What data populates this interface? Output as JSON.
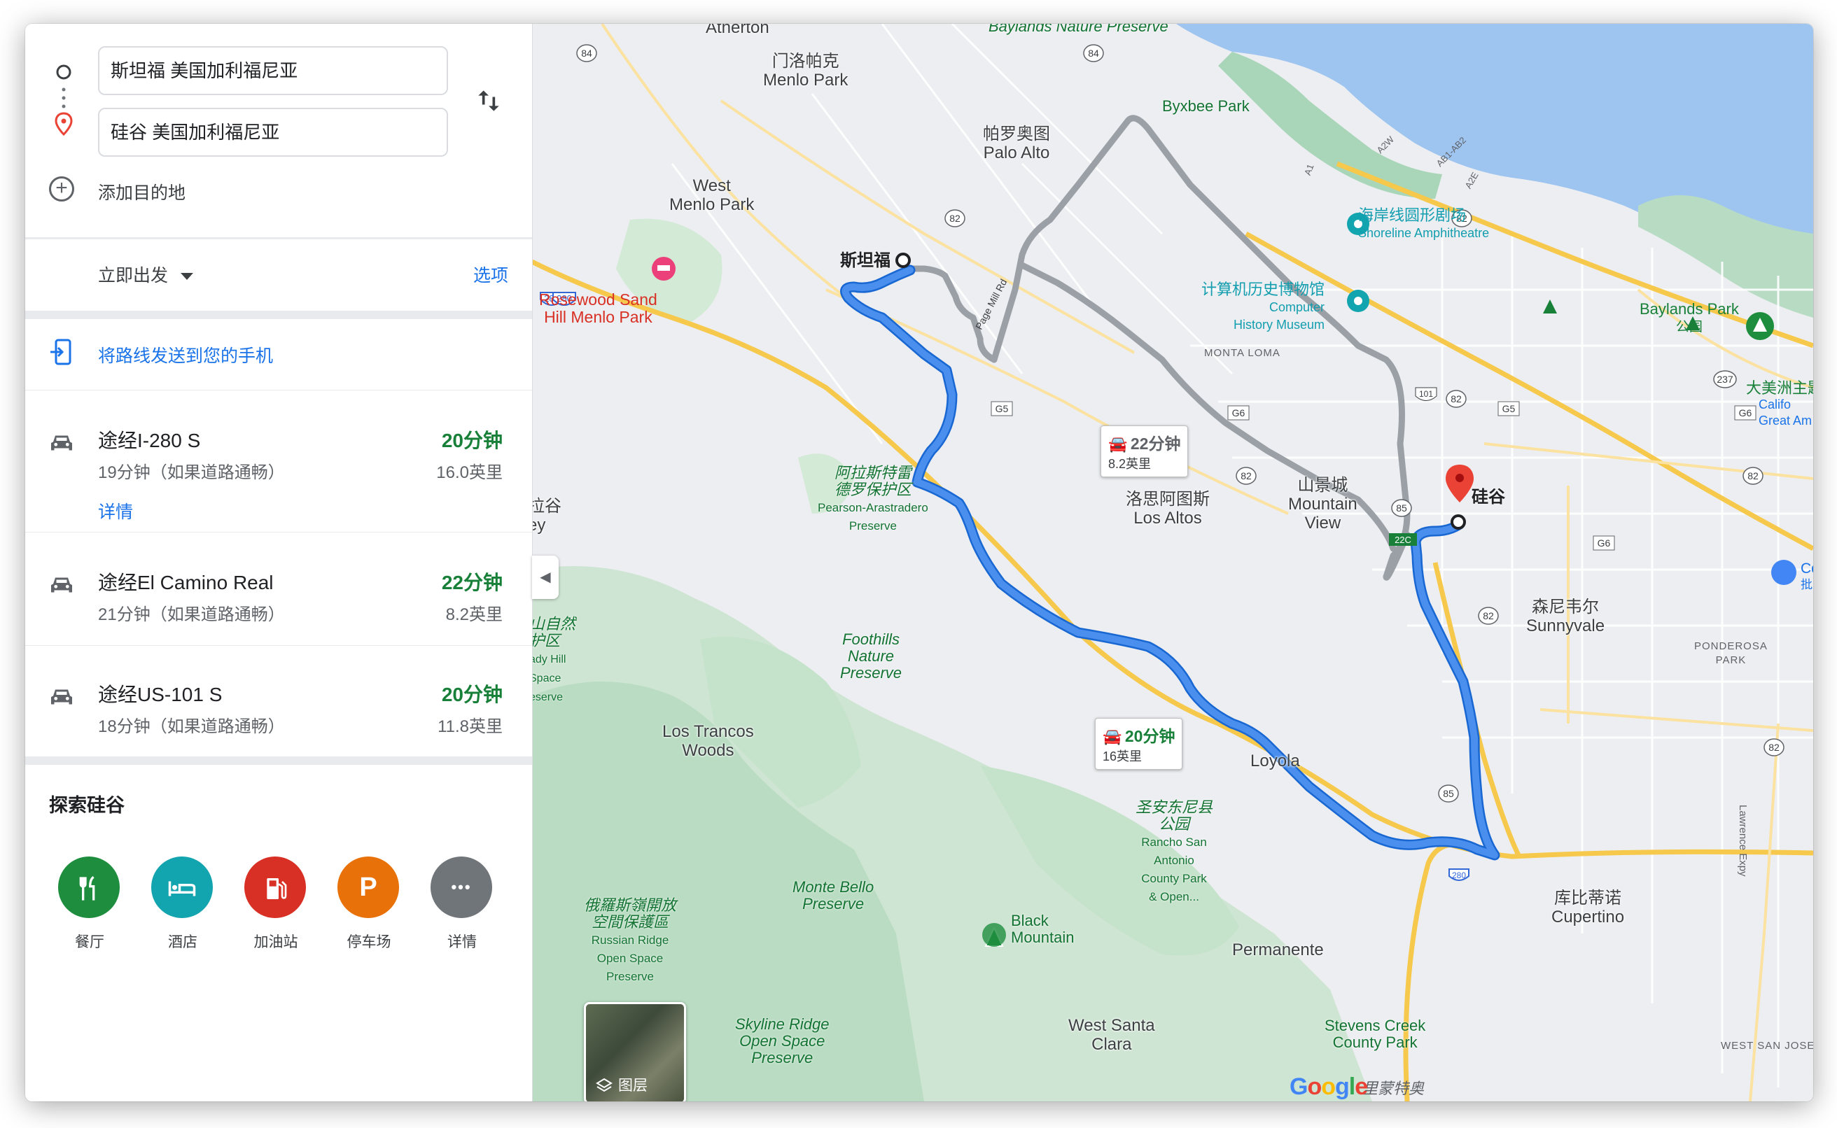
{
  "directions": {
    "origin": "斯坦福 美国加利福尼亚",
    "destination": "硅谷 美国加利福尼亚",
    "add_destination": "添加目的地",
    "depart_label": "立即出发",
    "options_label": "选项",
    "send_to_phone": "将路线发送到您的手机"
  },
  "routes": [
    {
      "title": "途经I-280 S",
      "subtitle": "19分钟（如果道路通畅）",
      "time": "20分钟",
      "distance": "16.0英里",
      "details": "详情"
    },
    {
      "title": "途经El Camino Real",
      "subtitle": "21分钟（如果道路通畅）",
      "time": "22分钟",
      "distance": "8.2英里"
    },
    {
      "title": "途经US-101 S",
      "subtitle": "18分钟（如果道路通畅）",
      "time": "20分钟",
      "distance": "11.8英里"
    }
  ],
  "explore": {
    "title": "探索硅谷",
    "categories": [
      {
        "label": "餐厅",
        "icon": "restaurant-icon",
        "glyph": "🍴",
        "color": "#1e8e3e"
      },
      {
        "label": "酒店",
        "icon": "hotel-icon",
        "glyph": "🛏",
        "color": "#12a4af"
      },
      {
        "label": "加油站",
        "icon": "gas-station-icon",
        "glyph": "⛽",
        "color": "#d93025"
      },
      {
        "label": "停车场",
        "icon": "parking-icon",
        "glyph": "P",
        "color": "#e8710a"
      },
      {
        "label": "详情",
        "icon": "more-icon",
        "glyph": "•••",
        "color": "#70757a"
      }
    ]
  },
  "map": {
    "layers_label": "图层",
    "route_badges": [
      {
        "time": "22分钟",
        "distance": "8.2英里",
        "color": "#5f6368"
      },
      {
        "time": "20分钟",
        "distance": "16英里",
        "color": "#188038"
      }
    ],
    "origin_label": "斯坦福",
    "destination_label": "硅谷",
    "labels": {
      "atherton": "Atherton",
      "menlo_park_cn": "门洛帕克",
      "menlo_park": "Menlo Park",
      "palo_alto_cn": "帕罗奥图",
      "palo_alto": "Palo Alto",
      "west_menlo_cn": "West",
      "west_menlo": "Menlo Park",
      "byxbee": "Byxbee Park",
      "baylands_top": "Baylands Nature Preserve",
      "shoreline_cn": "海岸线圆形剧场",
      "shoreline": "Shoreline Amphitheatre",
      "museum_cn": "计算机历史博物馆",
      "museum_en1": "Computer",
      "museum_en2": "History Museum",
      "rosewood1": "Rosewood Sand",
      "rosewood2": "Hill Menlo Park",
      "baylands_park": "Baylands Park",
      "baylands_park_cn": "公园",
      "america_cn": "大美洲主题",
      "america_1": "Califo",
      "america_2": "Great Am",
      "monta_loma": "MONTA LOMA",
      "los_altos_cn": "洛思阿图斯",
      "los_altos": "Los Altos",
      "mv_cn": "山景城",
      "mv_1": "Mountain",
      "mv_2": "View",
      "arastradero_cn1": "阿拉斯特雷",
      "arastradero_cn2": "德罗保护区",
      "arastradero_1": "Pearson-Arastradero",
      "arastradero_2": "Preserve",
      "sunnyvale_cn": "森尼韦尔",
      "sunnyvale": "Sunnyvale",
      "costco_1": "Cost",
      "costco_2": "批发市",
      "ponderosa_1": "PONDEROSA",
      "ponderosa_2": "PARK",
      "foothills_1": "Foothills",
      "foothills_2": "Nature",
      "foothills_3": "Preserve",
      "los_trancos_1": "Los Trancos",
      "los_trancos_2": "Woods",
      "loyola": "Loyola",
      "santa_antonio_cn1": "圣安东尼县",
      "santa_antonio_cn2": "公园",
      "santa_antonio_1": "Rancho San",
      "santa_antonio_2": "Antonio",
      "santa_antonio_3": "County Park",
      "santa_antonio_4": "& Open...",
      "cupertino_cn": "库比蒂诺",
      "cupertino": "Cupertino",
      "monte_bello_1": "Monte Bello",
      "monte_bello_2": "Preserve",
      "russian_cn1": "俄羅斯嶺開放",
      "russian_cn2": "空間保護區",
      "russian_1": "Russian Ridge",
      "russian_2": "Open Space",
      "russian_3": "Preserve",
      "black_mtn_1": "Black",
      "black_mtn_2": "Mountain",
      "permanente": "Permanente",
      "west_santa_1": "West Santa",
      "west_santa_2": "Clara",
      "stevens_1": "Stevens Creek",
      "stevens_2": "County Park",
      "skyline_1": "Skyline Ridge",
      "skyline_2": "Open Space",
      "skyline_3": "Preserve",
      "west_san_jose": "WEST SAN JOSE",
      "lawrence": "Lawrence Expy",
      "page_mill": "Page Mill Rd",
      "monte_sereno_cn": "里蒙特奥",
      "left_edge_1": "拉谷",
      "left_edge_2": "ey",
      "left_park_1": "山自然",
      "left_park_2": "护区",
      "left_park_3": "ady Hill",
      "left_park_4": "Space",
      "left_park_5": "eserve"
    },
    "shields": [
      "84",
      "82",
      "280",
      "G5",
      "G6",
      "82",
      "101",
      "85",
      "22C",
      "82",
      "G6",
      "237",
      "82",
      "85",
      "280",
      "A1",
      "A2W",
      "AB1-AB2",
      "A2E"
    ],
    "google_logo": "Google"
  }
}
